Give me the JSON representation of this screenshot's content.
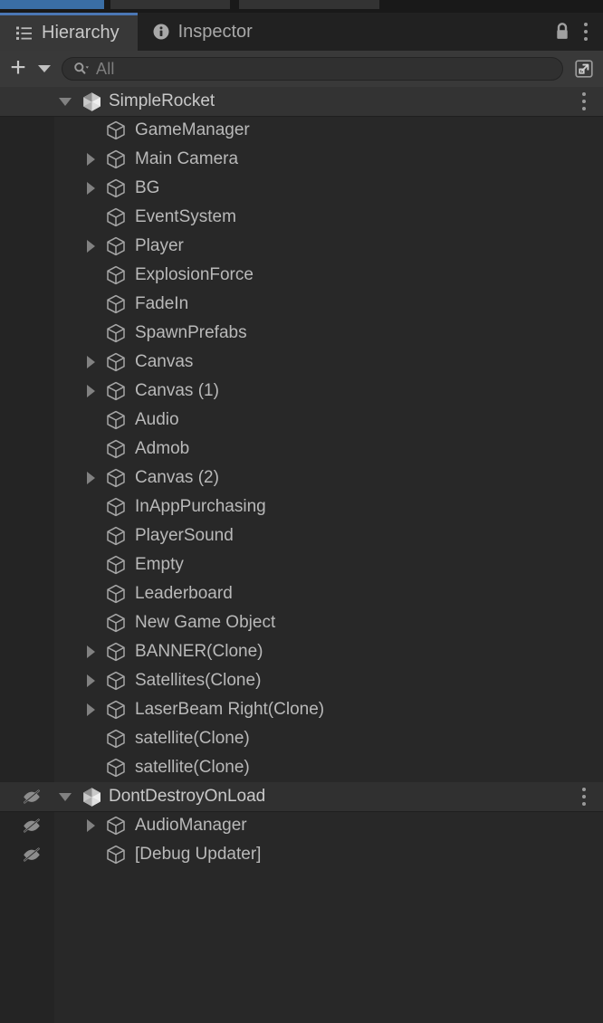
{
  "window": {
    "top_strip_tabs": [
      "",
      "",
      ""
    ]
  },
  "tabs": [
    {
      "label": "Hierarchy",
      "icon": "hierarchy-list-icon",
      "active": true
    },
    {
      "label": "Inspector",
      "icon": "info-circle-icon",
      "active": false
    }
  ],
  "tabbar_right": {
    "lock_icon": "lock-icon",
    "menu_icon": "kebab-menu-icon"
  },
  "toolbar": {
    "add_label": "+",
    "add_icon": "plus-icon",
    "add_dropdown_icon": "chevron-down-icon",
    "search_icon": "search-icon",
    "search_value": "",
    "search_placeholder": "All",
    "expand_icon": "open-in-new-window-icon"
  },
  "colors": {
    "accent_blue": "#4b77b5",
    "panel_bg": "#282828",
    "tabbar_bg": "#212121",
    "toolbar_bg": "#393939",
    "scene_row_bg": "#333333",
    "gutter_bg": "#242424",
    "text": "#b9b9b9",
    "icon_outline": "#a0a0a0"
  },
  "hierarchy": {
    "rows": [
      {
        "name": "SimpleRocket",
        "type": "scene",
        "icon": "unity-scene-icon",
        "depth": 0,
        "foldout": "down",
        "kebab": true,
        "hidden_marker": false
      },
      {
        "name": "GameManager",
        "type": "gameobject",
        "icon": "gameobject-cube-icon",
        "depth": 1,
        "foldout": "none",
        "kebab": false,
        "hidden_marker": false
      },
      {
        "name": "Main Camera",
        "type": "gameobject",
        "icon": "gameobject-cube-icon",
        "depth": 1,
        "foldout": "right",
        "kebab": false,
        "hidden_marker": false
      },
      {
        "name": "BG",
        "type": "gameobject",
        "icon": "gameobject-cube-icon",
        "depth": 1,
        "foldout": "right",
        "kebab": false,
        "hidden_marker": false
      },
      {
        "name": "EventSystem",
        "type": "gameobject",
        "icon": "gameobject-cube-icon",
        "depth": 1,
        "foldout": "none",
        "kebab": false,
        "hidden_marker": false
      },
      {
        "name": "Player",
        "type": "gameobject",
        "icon": "gameobject-cube-icon",
        "depth": 1,
        "foldout": "right",
        "kebab": false,
        "hidden_marker": false
      },
      {
        "name": "ExplosionForce",
        "type": "gameobject",
        "icon": "gameobject-cube-icon",
        "depth": 1,
        "foldout": "none",
        "kebab": false,
        "hidden_marker": false
      },
      {
        "name": "FadeIn",
        "type": "gameobject",
        "icon": "gameobject-cube-icon",
        "depth": 1,
        "foldout": "none",
        "kebab": false,
        "hidden_marker": false
      },
      {
        "name": "SpawnPrefabs",
        "type": "gameobject",
        "icon": "gameobject-cube-icon",
        "depth": 1,
        "foldout": "none",
        "kebab": false,
        "hidden_marker": false
      },
      {
        "name": "Canvas",
        "type": "gameobject",
        "icon": "gameobject-cube-icon",
        "depth": 1,
        "foldout": "right",
        "kebab": false,
        "hidden_marker": false
      },
      {
        "name": "Canvas (1)",
        "type": "gameobject",
        "icon": "gameobject-cube-icon",
        "depth": 1,
        "foldout": "right",
        "kebab": false,
        "hidden_marker": false
      },
      {
        "name": "Audio",
        "type": "gameobject",
        "icon": "gameobject-cube-icon",
        "depth": 1,
        "foldout": "none",
        "kebab": false,
        "hidden_marker": false
      },
      {
        "name": "Admob",
        "type": "gameobject",
        "icon": "gameobject-cube-icon",
        "depth": 1,
        "foldout": "none",
        "kebab": false,
        "hidden_marker": false
      },
      {
        "name": "Canvas (2)",
        "type": "gameobject",
        "icon": "gameobject-cube-icon",
        "depth": 1,
        "foldout": "right",
        "kebab": false,
        "hidden_marker": false
      },
      {
        "name": "InAppPurchasing",
        "type": "gameobject",
        "icon": "gameobject-cube-icon",
        "depth": 1,
        "foldout": "none",
        "kebab": false,
        "hidden_marker": false
      },
      {
        "name": "PlayerSound",
        "type": "gameobject",
        "icon": "gameobject-cube-icon",
        "depth": 1,
        "foldout": "none",
        "kebab": false,
        "hidden_marker": false
      },
      {
        "name": "Empty",
        "type": "gameobject",
        "icon": "gameobject-cube-icon",
        "depth": 1,
        "foldout": "none",
        "kebab": false,
        "hidden_marker": false
      },
      {
        "name": "Leaderboard",
        "type": "gameobject",
        "icon": "gameobject-cube-icon",
        "depth": 1,
        "foldout": "none",
        "kebab": false,
        "hidden_marker": false
      },
      {
        "name": "New Game Object",
        "type": "gameobject",
        "icon": "gameobject-cube-icon",
        "depth": 1,
        "foldout": "none",
        "kebab": false,
        "hidden_marker": false
      },
      {
        "name": "BANNER(Clone)",
        "type": "gameobject",
        "icon": "gameobject-cube-icon",
        "depth": 1,
        "foldout": "right",
        "kebab": false,
        "hidden_marker": false
      },
      {
        "name": "Satellites(Clone)",
        "type": "gameobject",
        "icon": "gameobject-cube-icon",
        "depth": 1,
        "foldout": "right",
        "kebab": false,
        "hidden_marker": false
      },
      {
        "name": "LaserBeam Right(Clone)",
        "type": "gameobject",
        "icon": "gameobject-cube-icon",
        "depth": 1,
        "foldout": "right",
        "kebab": false,
        "hidden_marker": false
      },
      {
        "name": "satellite(Clone)",
        "type": "gameobject",
        "icon": "gameobject-cube-icon",
        "depth": 1,
        "foldout": "none",
        "kebab": false,
        "hidden_marker": false
      },
      {
        "name": "satellite(Clone)",
        "type": "gameobject",
        "icon": "gameobject-cube-icon",
        "depth": 1,
        "foldout": "none",
        "kebab": false,
        "hidden_marker": false
      },
      {
        "name": "DontDestroyOnLoad",
        "type": "scene",
        "icon": "unity-scene-icon",
        "depth": 0,
        "foldout": "down",
        "kebab": true,
        "hidden_marker": true
      },
      {
        "name": "AudioManager",
        "type": "gameobject",
        "icon": "gameobject-cube-icon",
        "depth": 1,
        "foldout": "right",
        "kebab": false,
        "hidden_marker": true
      },
      {
        "name": "[Debug Updater]",
        "type": "gameobject",
        "icon": "gameobject-cube-icon",
        "depth": 1,
        "foldout": "none",
        "kebab": false,
        "hidden_marker": true
      }
    ]
  }
}
